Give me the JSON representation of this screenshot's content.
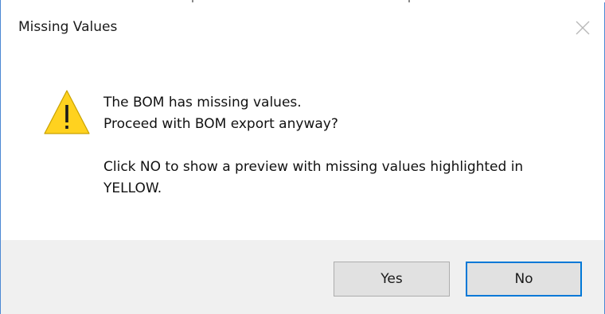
{
  "dialog": {
    "title": "Missing Values",
    "icon": "warning-icon",
    "message_line1": "The BOM has missing values.",
    "message_line2": "Proceed with BOM export anyway?",
    "message_line3": "Click NO to show a preview with missing values highlighted in",
    "message_line4": "YELLOW.",
    "buttons": {
      "yes_label": "Yes",
      "no_label": "No"
    },
    "default_button": "No"
  },
  "colors": {
    "accent": "#0078d7",
    "window_border": "#4b88d4",
    "footer_background": "#f0f0f0",
    "button_face": "#e1e1e1",
    "warning_yellow": "#ffd21f"
  }
}
